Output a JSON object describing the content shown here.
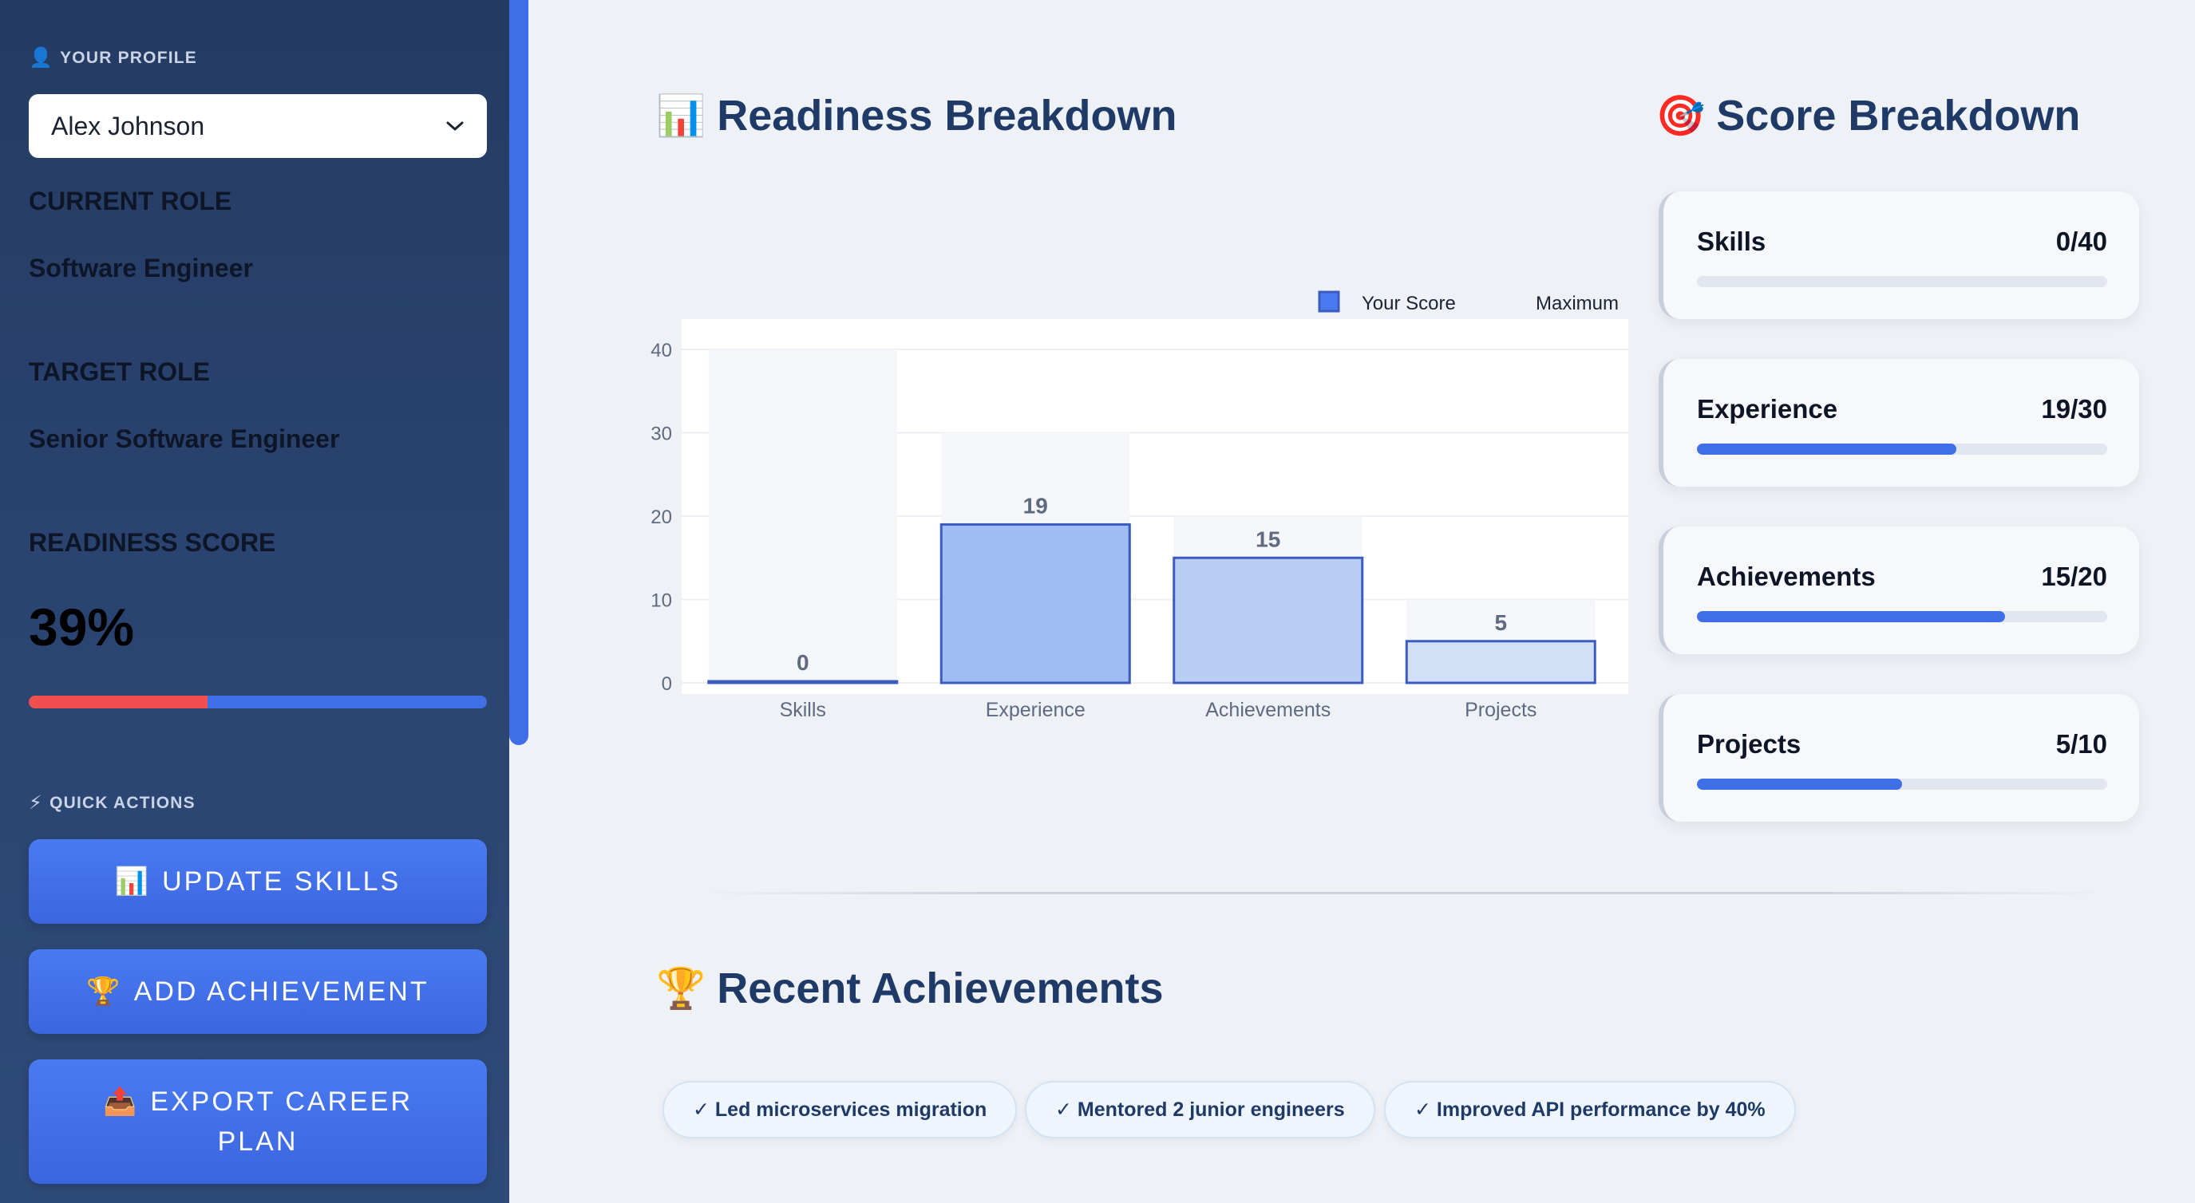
{
  "sidebar": {
    "profile_heading": "YOUR PROFILE",
    "profile_select": "Alex Johnson",
    "current_role_label": "CURRENT ROLE",
    "current_role": "Software Engineer",
    "target_role_label": "TARGET ROLE",
    "target_role": "Senior Software Engineer",
    "readiness_label": "READINESS SCORE",
    "readiness_value": "39%",
    "readiness_fraction": 0.39,
    "quick_actions_heading": "QUICK ACTIONS",
    "buttons": [
      {
        "icon": "📊",
        "label": "UPDATE SKILLS"
      },
      {
        "icon": "🏆",
        "label": "ADD ACHIEVEMENT"
      },
      {
        "icon": "📤",
        "label": "EXPORT CAREER PLAN"
      }
    ]
  },
  "main": {
    "readiness_title": "Readiness Breakdown",
    "readiness_icon": "📊",
    "score_title": "Score Breakdown",
    "score_icon": "🎯",
    "achievements_title": "Recent Achievements",
    "achievements_icon": "🏆",
    "score_cards": [
      {
        "name": "Skills",
        "score": "0/40",
        "fraction": 0.0
      },
      {
        "name": "Experience",
        "score": "19/30",
        "fraction": 0.633
      },
      {
        "name": "Achievements",
        "score": "15/20",
        "fraction": 0.75
      },
      {
        "name": "Projects",
        "score": "5/10",
        "fraction": 0.5
      }
    ],
    "achievements": [
      "✓ Led microservices migration",
      "✓ Mentored 2 junior engineers",
      "✓ Improved API performance by 40%"
    ]
  },
  "chart_data": {
    "type": "bar",
    "categories": [
      "Skills",
      "Experience",
      "Achievements",
      "Projects"
    ],
    "series": [
      {
        "name": "Your Score",
        "values": [
          0,
          19,
          15,
          5
        ]
      },
      {
        "name": "Maximum",
        "values": [
          40,
          30,
          20,
          10
        ]
      }
    ],
    "ylim": [
      0,
      40
    ],
    "yticks": [
      0,
      10,
      20,
      30,
      40
    ],
    "legend": "top-right",
    "colors": {
      "your_score": [
        "#dbe6f8",
        "#9fbdf2",
        "#b8cff3",
        "#d2e0f7"
      ],
      "your_score_border": "#3c5bbf",
      "maximum": "#f4f6f9"
    }
  }
}
